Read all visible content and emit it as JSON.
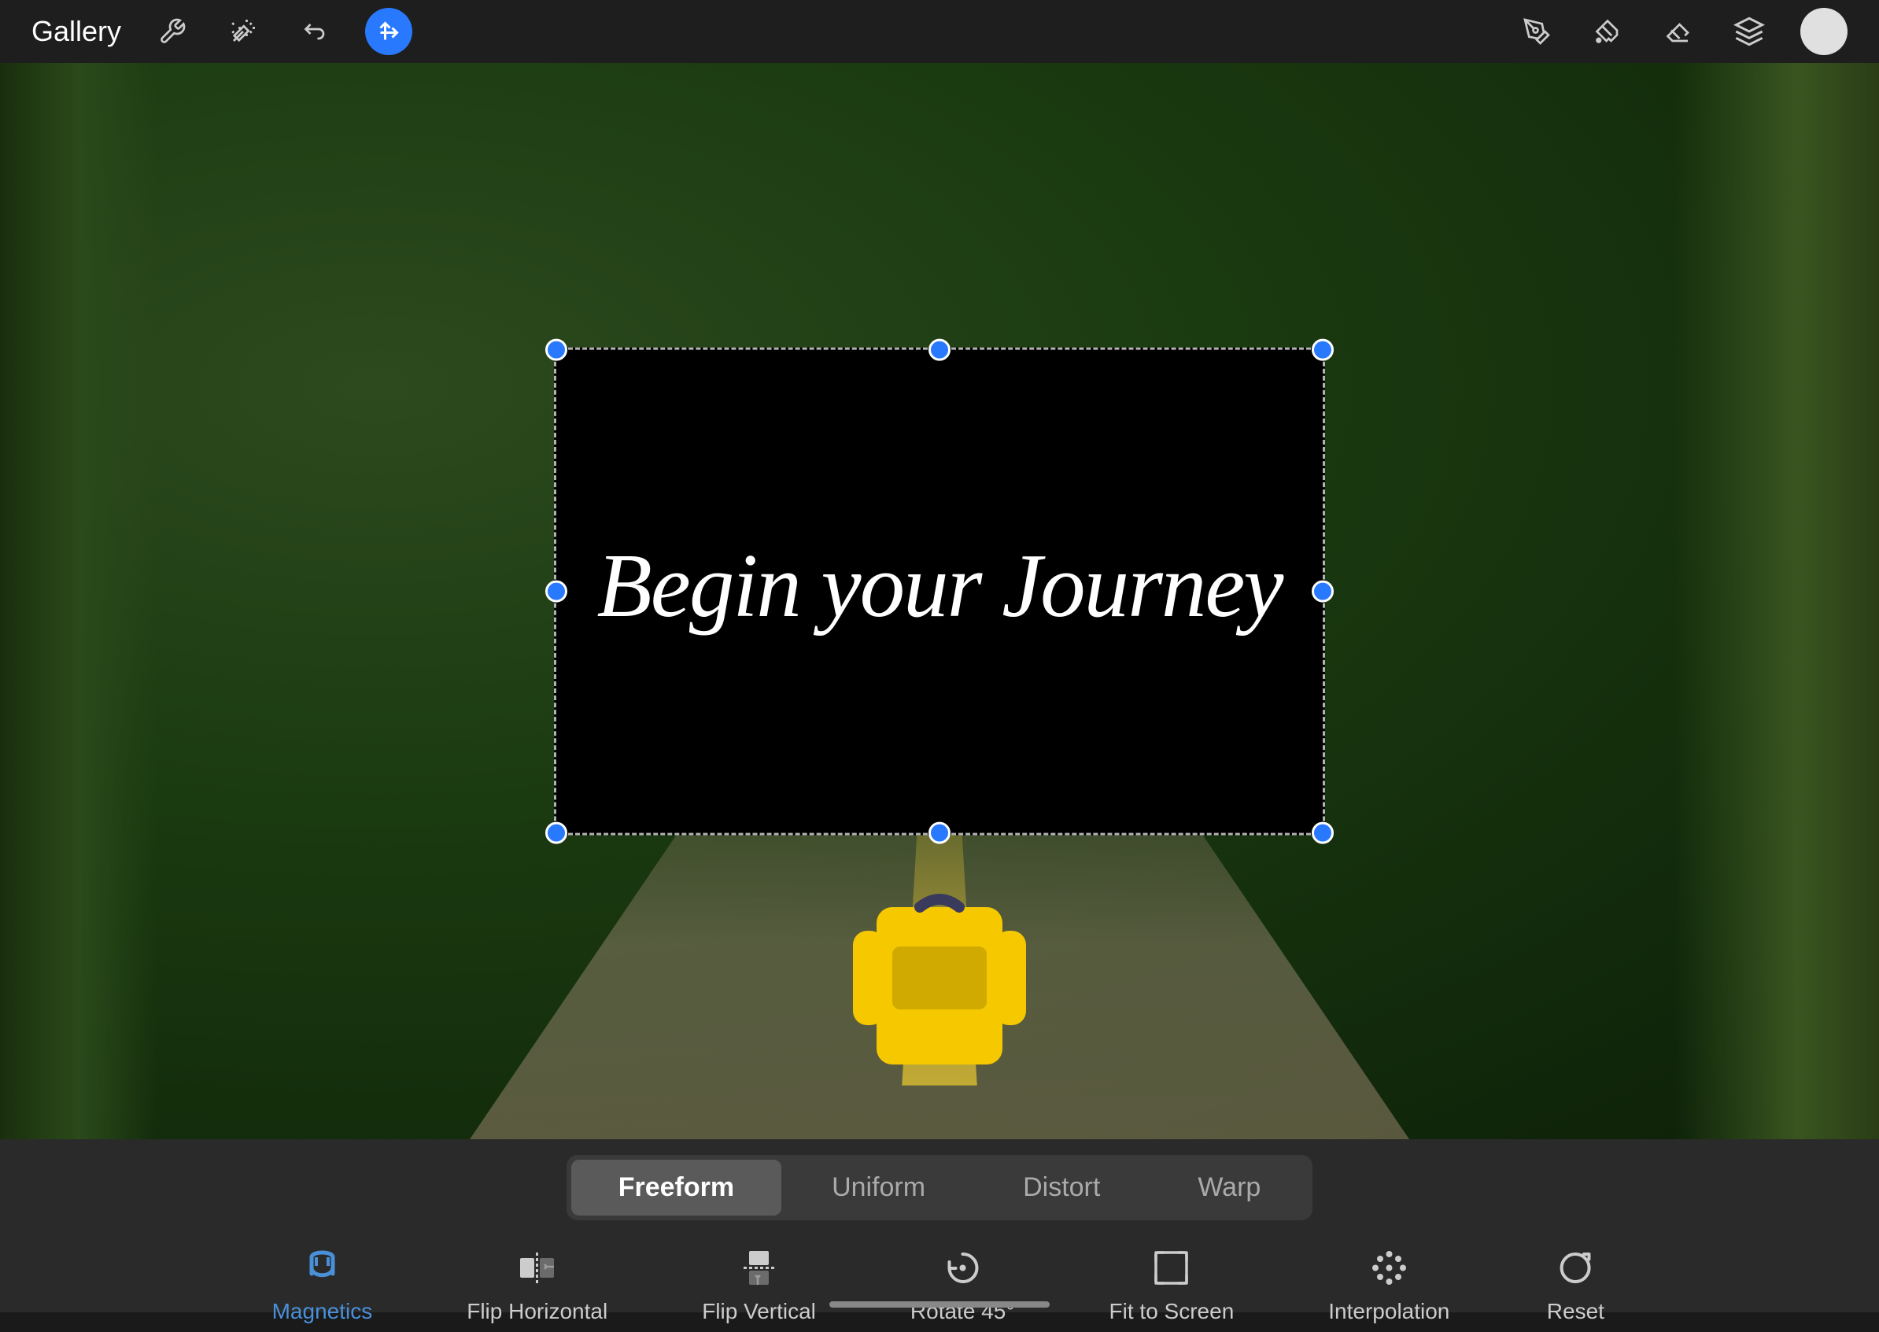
{
  "topbar": {
    "gallery_label": "Gallery",
    "icons": [
      "wrench",
      "magic",
      "strikethrough",
      "cursor"
    ],
    "right_icons": [
      "pen",
      "pipette",
      "eraser",
      "layers",
      "avatar"
    ]
  },
  "canvas": {
    "text_content": "Begin your Journey",
    "layer_bg": "black"
  },
  "tabs": [
    {
      "id": "freeform",
      "label": "Freeform",
      "active": true
    },
    {
      "id": "uniform",
      "label": "Uniform",
      "active": false
    },
    {
      "id": "distort",
      "label": "Distort",
      "active": false
    },
    {
      "id": "warp",
      "label": "Warp",
      "active": false
    }
  ],
  "actions": [
    {
      "id": "magnetics",
      "label": "Magnetics",
      "icon": "↺",
      "active": true
    },
    {
      "id": "flip-horizontal",
      "label": "Flip Horizontal",
      "icon": "→",
      "active": false
    },
    {
      "id": "flip-vertical",
      "label": "Flip Vertical",
      "icon": "↑",
      "active": false
    },
    {
      "id": "rotate-45",
      "label": "Rotate 45°",
      "icon": "↻",
      "active": false
    },
    {
      "id": "fit-to-screen",
      "label": "Fit to Screen",
      "icon": "⊞",
      "active": false
    },
    {
      "id": "interpolation",
      "label": "Interpolation",
      "icon": "⊹",
      "active": false
    },
    {
      "id": "reset",
      "label": "Reset",
      "icon": "↺",
      "active": false
    }
  ]
}
